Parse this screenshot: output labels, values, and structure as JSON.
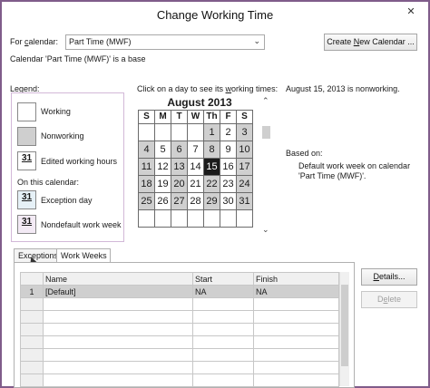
{
  "window": {
    "title": "Change Working Time",
    "close_glyph": "✕"
  },
  "for_calendar": {
    "label_prefix": "For ",
    "label_underlined": "c",
    "label_suffix": "alendar:",
    "value": "Part Time (MWF)",
    "arrow": "⌄"
  },
  "base_text": "Calendar 'Part Time (MWF)' is a base",
  "create_button": {
    "prefix": "Create ",
    "underlined": "N",
    "suffix": "ew Calendar ..."
  },
  "legend": {
    "title": "Legend:",
    "working": "Working",
    "nonworking": "Nonworking",
    "edited": "Edited working hours",
    "on_this_calendar": "On this calendar:",
    "exception": "Exception day",
    "nondefault": "Nondefault work week",
    "swatch_num": "31"
  },
  "calendar": {
    "instruction_prefix": "Click on a day to see its ",
    "instruction_underlined": "w",
    "instruction_suffix": "orking times:",
    "month": "August 2013",
    "day_headers": [
      "S",
      "M",
      "T",
      "W",
      "Th",
      "F",
      "S"
    ],
    "weeks": [
      [
        "",
        "",
        "",
        "",
        "1",
        "2",
        "3"
      ],
      [
        "4",
        "5",
        "6",
        "7",
        "8",
        "9",
        "10"
      ],
      [
        "11",
        "12",
        "13",
        "14",
        "15",
        "16",
        "17"
      ],
      [
        "18",
        "19",
        "20",
        "21",
        "22",
        "23",
        "24"
      ],
      [
        "25",
        "26",
        "27",
        "28",
        "29",
        "30",
        "31"
      ],
      [
        "",
        "",
        "",
        "",
        "",
        "",
        ""
      ]
    ],
    "selected_day": "15",
    "scroll_up": "⌃",
    "scroll_down": "⌄"
  },
  "day_info": "August 15, 2013 is nonworking.",
  "based_on": {
    "label": "Based on:",
    "text_line1": "Default work week on calendar",
    "text_line2": "'Part Time (MWF)'."
  },
  "tabs": [
    {
      "label": "Exceptions"
    },
    {
      "label": "Work Weeks"
    }
  ],
  "grid": {
    "headers": [
      "",
      "Name",
      "Start",
      "Finish"
    ],
    "rows": [
      {
        "num": "1",
        "name": "[Default]",
        "start": "NA",
        "finish": "NA"
      }
    ]
  },
  "details_button": {
    "underlined": "D",
    "suffix": "etails..."
  },
  "delete_button": {
    "prefix": "D",
    "underlined": "e",
    "suffix": "lete"
  }
}
